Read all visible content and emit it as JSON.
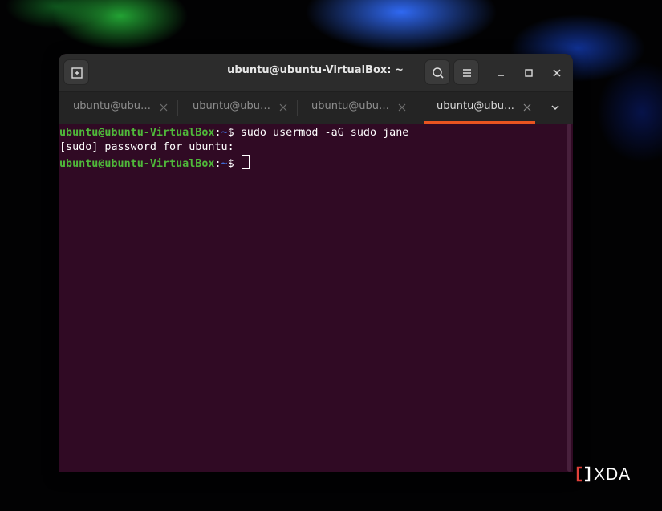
{
  "window": {
    "title": "ubuntu@ubuntu-VirtualBox: ~"
  },
  "header_buttons": {
    "new_tab": "new-tab-icon",
    "search": "search-icon",
    "menu": "hamburger-menu-icon",
    "minimize": "minimize-icon",
    "maximize": "maximize-icon",
    "close": "close-icon"
  },
  "tabs": [
    {
      "label": "ubuntu@ubuntu-VirtualBox: ~",
      "active": false
    },
    {
      "label": "ubuntu@ubuntu-VirtualBox: ~",
      "active": false
    },
    {
      "label": "ubuntu@ubuntu-VirtualBox: ~",
      "active": false
    },
    {
      "label": "ubuntu@ubuntu-VirtualBox: ~",
      "active": true
    }
  ],
  "terminal": {
    "lines": [
      {
        "user": "ubuntu@ubuntu-VirtualBox",
        "sep": ":",
        "path": "~",
        "symbol": "$ ",
        "command": "sudo usermod -aG sudo jane"
      },
      {
        "output": "[sudo] password for ubuntu:"
      },
      {
        "user": "ubuntu@ubuntu-VirtualBox",
        "sep": ":",
        "path": "~",
        "symbol": "$ ",
        "command": ""
      }
    ]
  },
  "watermark": {
    "text": "XDA"
  },
  "colors": {
    "terminal_bg": "#300a24",
    "prompt_user": "#4fb83a",
    "prompt_path": "#3f6ad3",
    "active_tab_accent": "#e95420",
    "titlebar_bg": "#2c2c2c",
    "tabbar_bg": "#242424"
  }
}
